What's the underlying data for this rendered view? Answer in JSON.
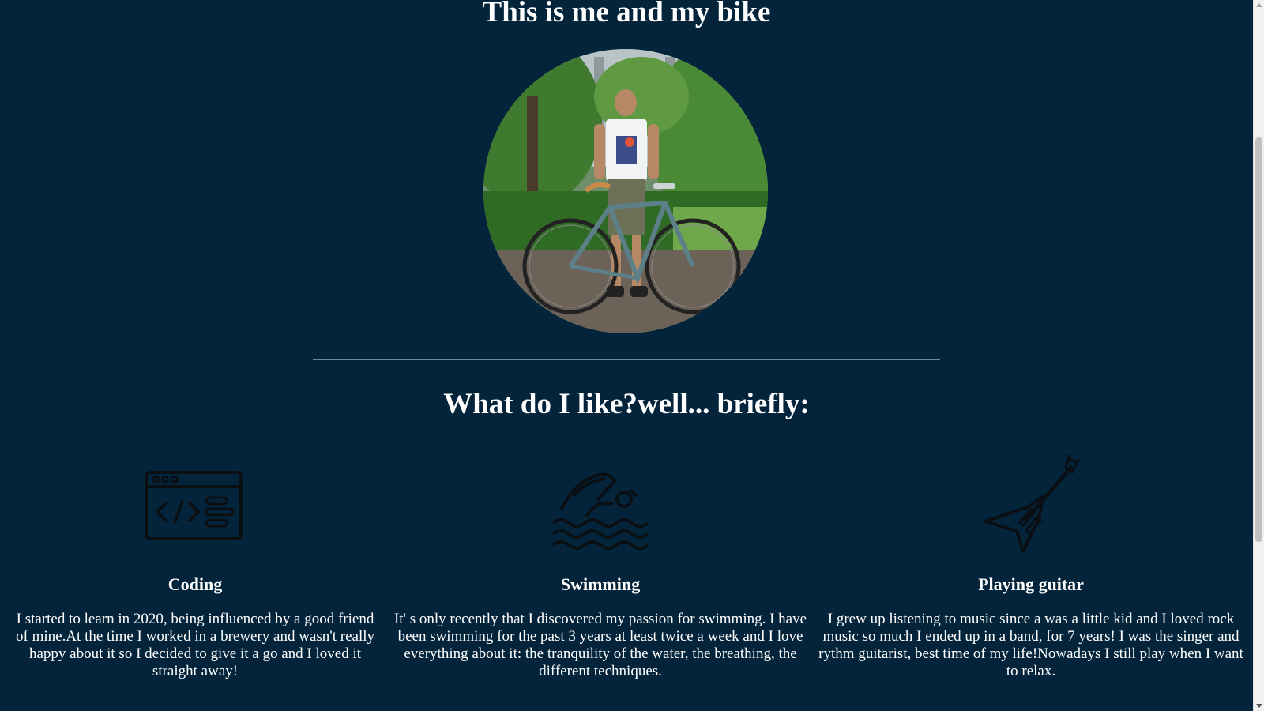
{
  "hero": {
    "title": "This is me and my bike"
  },
  "likes": {
    "title": "What do I like?well... briefly:",
    "items": [
      {
        "icon": "code-window-icon",
        "title": "Coding",
        "text": "I started to learn in 2020, being influenced by a good friend of mine.At the time I worked in a brewery and wasn't really happy about it so I decided to give it a go and I loved it straight away!"
      },
      {
        "icon": "swimmer-icon",
        "title": "Swimming",
        "text": "It' s only recently that I discovered my passion for swimming. I have been swimming for the past 3 years at least twice a week and I love everything about it: the tranquility of the water, the breathing, the different techniques."
      },
      {
        "icon": "electric-guitar-icon",
        "title": "Playing guitar",
        "text": "I grew up listening to music since a was a little kid and I loved rock music so much I ended up in a band, for 7 years! I was the singer and rythm guitarist, best time of my life!Nowadays I still play when I want to relax."
      }
    ]
  },
  "colors": {
    "background": "#03243a",
    "text": "#ffffff",
    "icon_stroke": "#0a0f14"
  }
}
